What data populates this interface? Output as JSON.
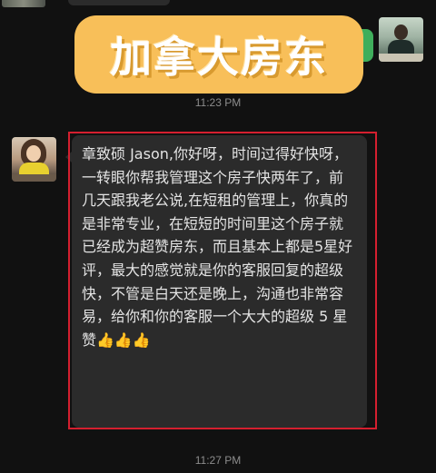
{
  "sent_message": {
    "text": "加拿大房东"
  },
  "timestamps": {
    "first": "11:23 PM",
    "second": "11:27 PM"
  },
  "received_message": {
    "text": "章致硕 Jason,你好呀，时间过得好快呀，一转眼你帮我管理这个房子快两年了，前几天跟我老公说,在短租的管理上，你真的是非常专业，在短短的时间里这个房子就已经成为超赞房东，而且基本上都是5星好评，最大的感觉就是你的客服回复的超级快，不管是白天还是晚上，沟通也非常容易，给你和你的客服一个大大的超级 5 星赞👍👍👍"
  },
  "colors": {
    "background": "#111111",
    "sent_bubble": "#f8bf59",
    "received_bubble": "#2b2b2b",
    "highlight_border": "#d41f2f",
    "timestamp": "#8d8d8d"
  },
  "icons": {
    "thumbs_up": "thumbs-up-emoji"
  }
}
